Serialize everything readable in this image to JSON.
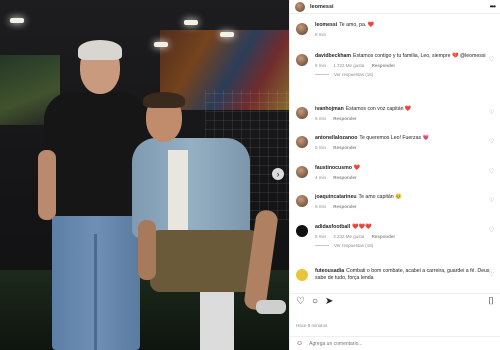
{
  "post": {
    "username": "leomessi"
  },
  "caption": {
    "username": "leomessi",
    "text": "Te amo, pa. ❤️",
    "time": "8 min"
  },
  "comments": [
    {
      "username": "davidbeckham",
      "text": "Estamos contigo y tu familia, Leo, siempre 💔 @leomessi",
      "time": "5 min",
      "likes": "1.722 Me gusta",
      "reply": "Responder",
      "replies": "Ver respuestas (16)"
    },
    {
      "username": "ivanhojman",
      "text": "Estamos con voz capitán ❤️",
      "time": "5 min",
      "reply": "Responder"
    },
    {
      "username": "antonellalozanoo",
      "text": "Te queremos Leo! Fuerzas 💗",
      "time": "5 min",
      "reply": "Responder"
    },
    {
      "username": "faustinocusmo",
      "text": "❤️",
      "time": "4 min",
      "reply": "Responder"
    },
    {
      "username": "joaquincatarineu",
      "text": "Te amo capitán 🥹",
      "time": "5 min",
      "reply": "Responder"
    },
    {
      "username": "adidasfootball",
      "text": "❤️❤️❤️",
      "time": "5 min",
      "likes": "4.232 Me gusta",
      "reply": "Responder",
      "replies": "Ver respuestas (15)"
    },
    {
      "username": "futeousadia",
      "text": "Combati o bom combate, acabei a carreira, guardei a fé. Deus sabe de tudo, força lenda",
      "time": "",
      "reply": ""
    }
  ],
  "actions": {
    "like": "♡",
    "comment": "○",
    "share": "➤",
    "save": "⌷"
  },
  "timestamp": "Hace 8 minutos",
  "add_comment": {
    "placeholder": "Agrega un comentario..."
  },
  "icons": {
    "more": "•••",
    "heart": "♡",
    "emoji": "☺",
    "next": "›"
  }
}
